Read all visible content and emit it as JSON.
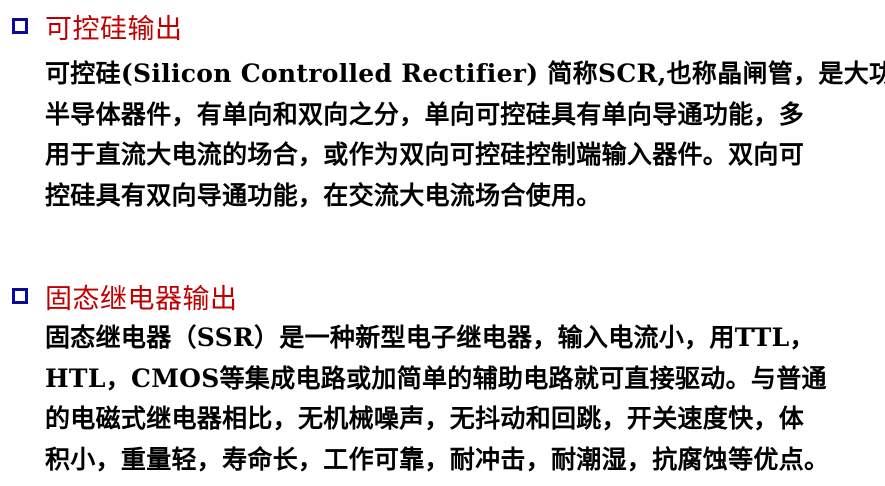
{
  "sections": [
    {
      "heading": "可控硅输出",
      "lines": [
        "可控硅(Silicon Controlled Rectifier) 简称SCR,也称晶闸管，是大功率",
        "半导体器件，有单向和双向之分，单向可控硅具有单向导通功能，多",
        "用于直流大电流的场合，或作为双向可控硅控制端输入器件。双向可",
        "控硅具有双向导通功能，在交流大电流场合使用。"
      ]
    },
    {
      "heading": "固态继电器输出",
      "lines": [
        "固态继电器（SSR）是一种新型电子继电器，输入电流小，用TTL，",
        "HTL，CMOS等集成电路或加简单的辅助电路就可直接驱动。与普通",
        "的电磁式继电器相比，无机械噪声，无抖动和回跳，开关速度快，体",
        "积小，重量轻，寿命长，工作可靠，耐冲击，耐潮湿，抗腐蚀等优点。"
      ]
    }
  ],
  "colors": {
    "heading": "#c00000",
    "bullet": "#0b0b9a",
    "body_text": "#000000",
    "background": "#ffffff"
  },
  "icons": {
    "bullet": "hollow-square-bullet-icon"
  }
}
